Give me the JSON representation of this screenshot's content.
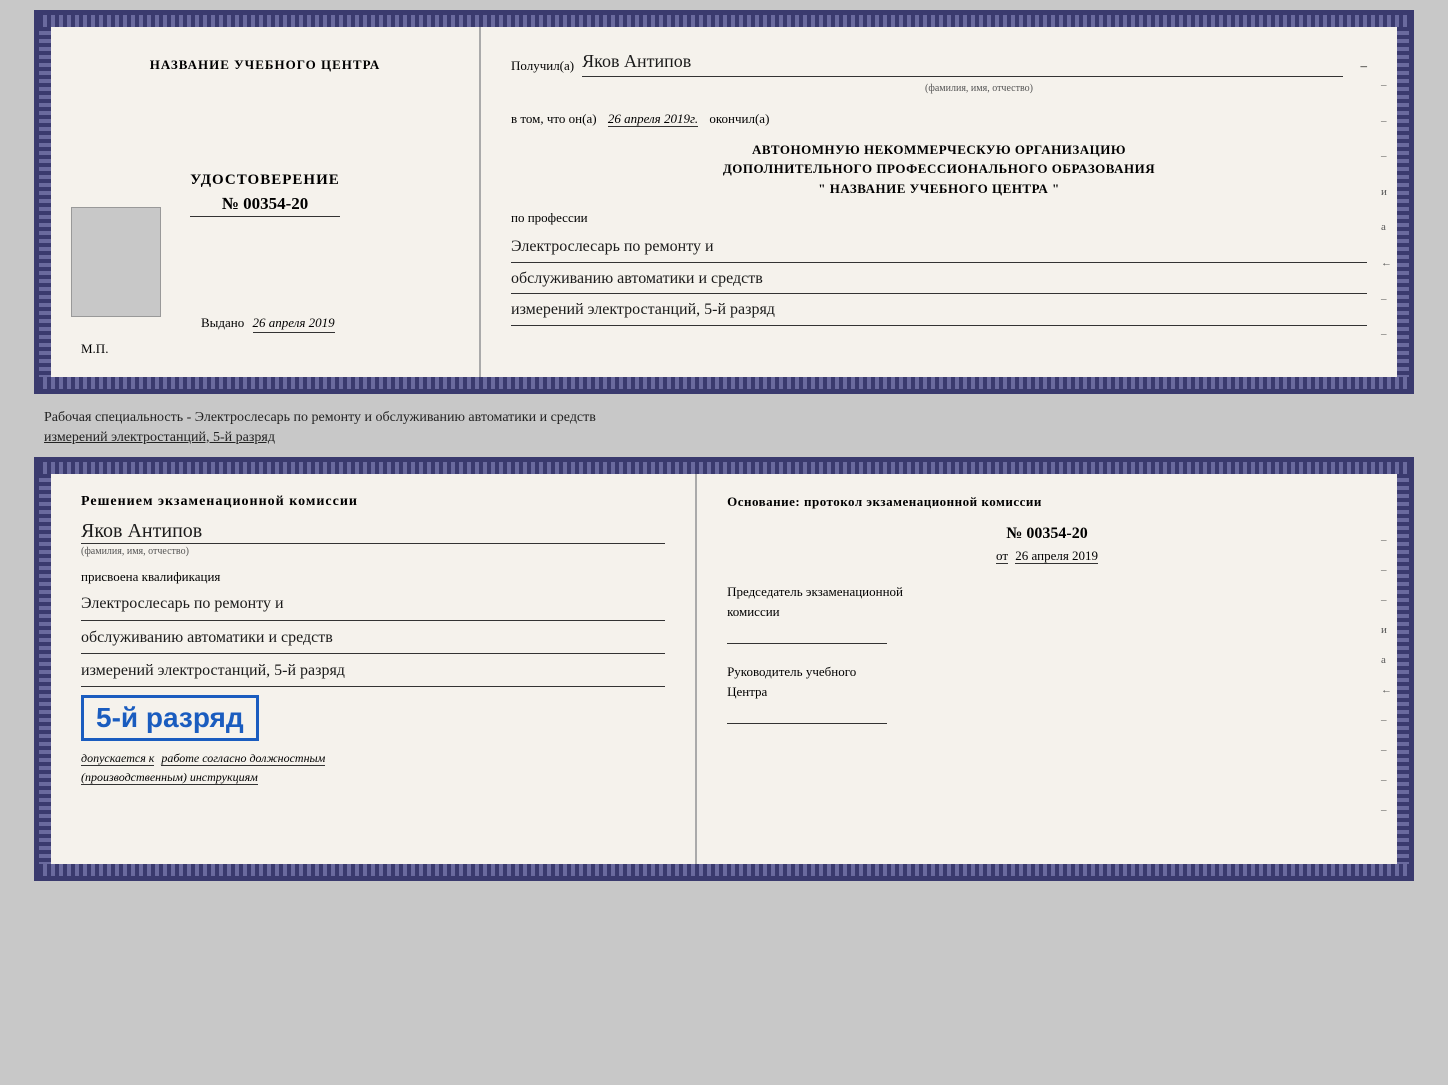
{
  "doc1": {
    "left": {
      "center_name": "НАЗВАНИЕ УЧЕБНОГО ЦЕНТРА",
      "title": "УДОСТОВЕРЕНИЕ",
      "number": "№ 00354-20",
      "vydano_label": "Выдано",
      "vydano_date": "26 апреля 2019",
      "mp": "М.П."
    },
    "right": {
      "poluchil_label": "Получил(а)",
      "receiver_name": "Яков Антипов",
      "fio_hint": "(фамилия, имя, отчество)",
      "v_tom_label": "в том, что он(а)",
      "v_tom_date": "26 апреля 2019г.",
      "okonchil": "окончил(а)",
      "org_line1": "АВТОНОМНУЮ НЕКОММЕРЧЕСКУЮ ОРГАНИЗАЦИЮ",
      "org_line2": "ДОПОЛНИТЕЛЬНОГО ПРОФЕССИОНАЛЬНОГО ОБРАЗОВАНИЯ",
      "org_quote": "\"    НАЗВАНИЕ УЧЕБНОГО ЦЕНТРА    \"",
      "po_professii": "по профессии",
      "profession_line1": "Электрослесарь по ремонту и",
      "profession_line2": "обслуживанию автоматики и средств",
      "profession_line3": "измерений электростанций, 5-й разряд",
      "side_marks": [
        "–",
        "–",
        "–",
        "и",
        "а",
        "←",
        "–",
        "–",
        "–",
        "–"
      ]
    }
  },
  "between_label": {
    "line1": "Рабочая специальность - Электрослесарь по ремонту и обслуживанию автоматики и средств",
    "line2": "измерений электростанций, 5-й разряд"
  },
  "doc2": {
    "left": {
      "reshenie_title": "Решением экзаменационной комиссии",
      "person_name": "Яков Антипов",
      "fio_hint": "(фамилия, имя, отчество)",
      "prisvoena": "присвоена квалификация",
      "qual_line1": "Электрослесарь по ремонту и",
      "qual_line2": "обслуживанию автоматики и средств",
      "qual_line3": "измерений электростанций, 5-й разряд",
      "razryad_badge": "5-й разряд",
      "допускается_label": "допускается к",
      "допускается_text": "работе согласно должностным",
      "допускается_text2": "(производственным) инструкциям"
    },
    "right": {
      "osnova_title": "Основание: протокол экзаменационной комиссии",
      "protocol_number": "№  00354-20",
      "protocol_date_prefix": "от",
      "protocol_date": "26 апреля 2019",
      "predsedatel_title": "Председатель экзаменационной",
      "predsedatel_subtitle": "комиссии",
      "rukovoditel_title": "Руководитель учебного",
      "rukovoditel_subtitle": "Центра",
      "side_marks": [
        "–",
        "–",
        "–",
        "и",
        "а",
        "←",
        "–",
        "–",
        "–",
        "–"
      ]
    }
  }
}
